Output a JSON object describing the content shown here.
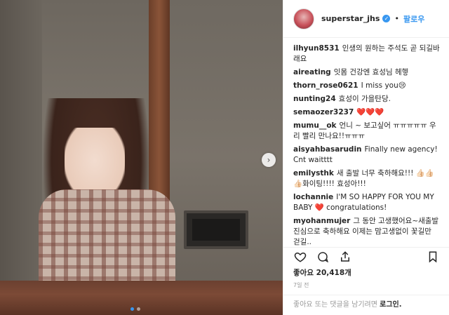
{
  "post": {
    "username": "superstar_jhs",
    "separator": "•",
    "follow_label": "팔로우"
  },
  "comments": [
    {
      "user": "ilhyun8531",
      "text": "인생의 원하는 주석도 곧 되길바래요"
    },
    {
      "user": "aireating",
      "text": "잇몸 건강엔 효성님 헤헿"
    },
    {
      "user": "thorn_rose0621",
      "text": "I miss you😢"
    },
    {
      "user": "nunting24",
      "text": "효성이 가을탄당."
    },
    {
      "user": "semaozer3237",
      "text": "❤️❤️❤️"
    },
    {
      "user": "mumu__ok",
      "text": "언니 ~ 보고싶어 ㅠㅠㅠㅠㅠ 우리 빨리 만나요!!ㅠㅠㅠ"
    },
    {
      "user": "aisyahbasarudin",
      "text": "Finally new agency! Cnt waitttt"
    },
    {
      "user": "emilysthk",
      "text": "새 출발 너무 축하해요!!! 👍🏻👍🏻👍🏻화이팅!!!! 효성아!!!"
    },
    {
      "user": "lochannie",
      "text": "I'M SO HAPPY FOR YOU MY BABY ❤️ congratulations!"
    },
    {
      "user": "myohanmujer",
      "text": "그 동안 고생했어요~새출발 진심으로 축하해요 이제는 맘고생없이 꽃길만 걷길.."
    }
  ],
  "stats": {
    "likes": "좋아요 20,418개",
    "time": "7일 전"
  },
  "add_comment": {
    "prompt": "좋아요 또는 댓글을 남기려면",
    "login": "로그인."
  },
  "icons": [
    "heart-icon",
    "comment-icon",
    "share-icon",
    "save-icon",
    "verified-icon",
    "next-arrow-icon"
  ],
  "colors": {
    "accent": "#3897f0",
    "text": "#262626",
    "muted": "#999999"
  },
  "carousel": {
    "dots": 2,
    "active": 1
  }
}
